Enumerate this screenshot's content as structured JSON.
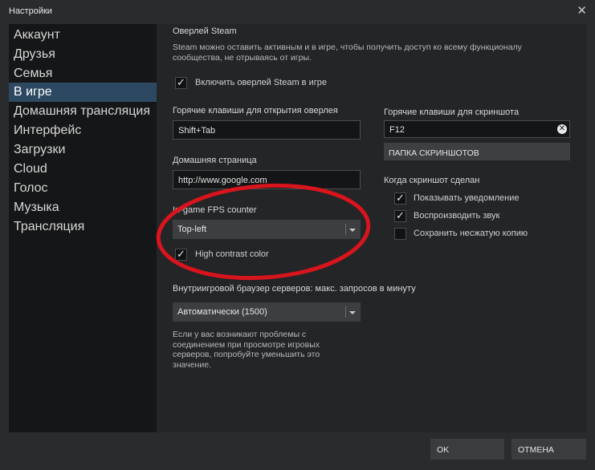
{
  "window": {
    "title": "Настройки",
    "close_glyph": "✕"
  },
  "sidebar": {
    "items": [
      {
        "label": "Аккаунт",
        "active": false
      },
      {
        "label": "Друзья",
        "active": false
      },
      {
        "label": "Семья",
        "active": false
      },
      {
        "label": "В игре",
        "active": true
      },
      {
        "label": "Домашняя трансляция",
        "active": false
      },
      {
        "label": "Интерфейс",
        "active": false
      },
      {
        "label": "Загрузки",
        "active": false
      },
      {
        "label": "Cloud",
        "active": false
      },
      {
        "label": "Голос",
        "active": false
      },
      {
        "label": "Музыка",
        "active": false
      },
      {
        "label": "Трансляция",
        "active": false
      }
    ]
  },
  "overlay": {
    "heading": "Оверлей Steam",
    "description": "Steam можно оставить активным и в игре, чтобы получить доступ ко всему функционалу сообщества, не отрываясь от игры.",
    "enable_label": "Включить оверлей Steam в игре",
    "enable_checked": true,
    "hotkeys_label": "Горячие клавиши для открытия оверлея",
    "hotkeys_value": "Shift+Tab",
    "homepage_label": "Домашняя страница",
    "homepage_value": "http://www.google.com"
  },
  "fps": {
    "label": "In-game FPS counter",
    "selected": "Top-left",
    "high_contrast_label": "High contrast color",
    "high_contrast_checked": true
  },
  "screenshot": {
    "hotkeys_label": "Горячие клавиши для скриншота",
    "hotkeys_value": "F12",
    "folder_button": "ПАПКА СКРИНШОТОВ",
    "when_taken_label": "Когда скриншот сделан",
    "options": [
      {
        "label": "Показывать уведомление",
        "checked": true
      },
      {
        "label": "Воспроизводить звук",
        "checked": true
      },
      {
        "label": "Сохранить несжатую копию",
        "checked": false
      }
    ]
  },
  "browser": {
    "label": "Внутриигровой браузер серверов: макс. запросов в минуту",
    "selected": "Автоматически (1500)",
    "note": "Если у вас возникают проблемы с соединением при просмотре игровых серверов, попробуйте уменьшить это значение."
  },
  "footer": {
    "ok_label": "OK",
    "cancel_label": "ОТМЕНА"
  },
  "colors": {
    "highlight_circle": "#d8141c",
    "active_item": "#2d4962"
  }
}
